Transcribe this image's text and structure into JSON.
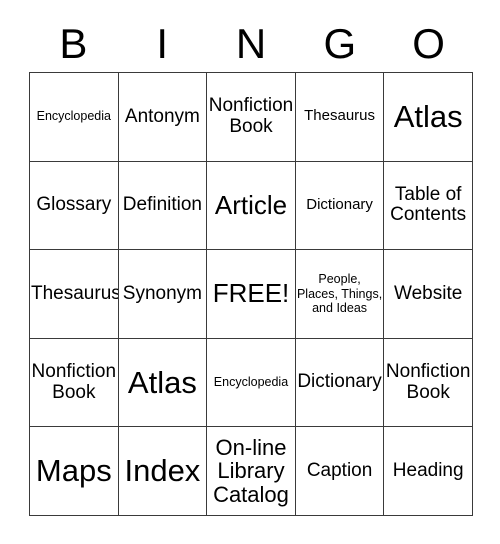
{
  "card": {
    "title": "BINGO Card",
    "header_letters": [
      "B",
      "I",
      "N",
      "G",
      "O"
    ],
    "text_color": "#000000",
    "border_color": "#3a3a3a",
    "background_color": "#ffffff",
    "rows": 5,
    "columns": 5,
    "cells": [
      [
        {
          "label": "Encyclopedia",
          "size": "xs"
        },
        {
          "label": "Antonym",
          "size": "m"
        },
        {
          "label": "Nonfiction Book",
          "size": "m"
        },
        {
          "label": "Thesaurus",
          "size": "s"
        },
        {
          "label": "Atlas",
          "size": "xl"
        }
      ],
      [
        {
          "label": "Glossary",
          "size": "m"
        },
        {
          "label": "Definition",
          "size": "m"
        },
        {
          "label": "Article",
          "size": "l"
        },
        {
          "label": "Dictionary",
          "size": "s"
        },
        {
          "label": "Table of Contents",
          "size": "m"
        }
      ],
      [
        {
          "label": "Thesaurus",
          "size": "m"
        },
        {
          "label": "Synonym",
          "size": "m"
        },
        {
          "label": "FREE!",
          "size": "l"
        },
        {
          "label": "People, Places, Things, and Ideas",
          "size": "xs"
        },
        {
          "label": "Website",
          "size": "m"
        }
      ],
      [
        {
          "label": "Nonfiction Book",
          "size": "m"
        },
        {
          "label": "Atlas",
          "size": "xl"
        },
        {
          "label": "Encyclopedia",
          "size": "xs"
        },
        {
          "label": "Dictionary",
          "size": "m"
        },
        {
          "label": "Nonfiction Book",
          "size": "m"
        }
      ],
      [
        {
          "label": "Maps",
          "size": "xl"
        },
        {
          "label": "Index",
          "size": "xl"
        },
        {
          "label": "On-line Library Catalog",
          "size": "ml"
        },
        {
          "label": "Caption",
          "size": "m"
        },
        {
          "label": "Heading",
          "size": "m"
        }
      ]
    ]
  }
}
